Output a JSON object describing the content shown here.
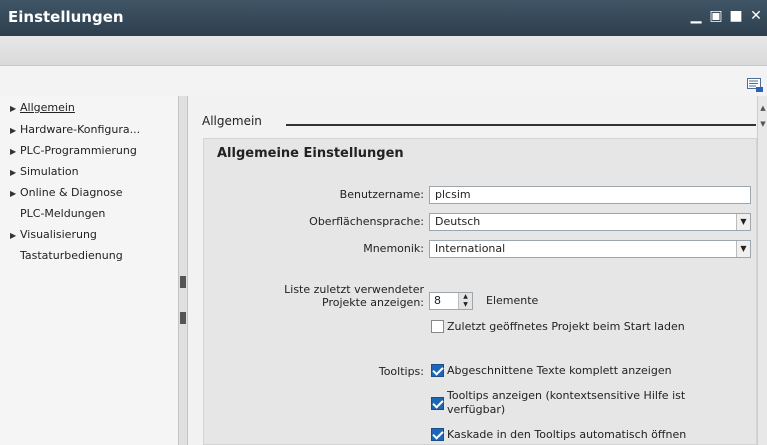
{
  "window": {
    "title": "Einstellungen",
    "controls": {
      "minimize": "▁",
      "restore": "▣",
      "maximize": "■",
      "close": "✕"
    }
  },
  "nav": {
    "items": [
      {
        "label": "Allgemein",
        "expandable": true,
        "active": true
      },
      {
        "label": "Hardware-Konfigura...",
        "expandable": true
      },
      {
        "label": "PLC-Programmierung",
        "expandable": true
      },
      {
        "label": "Simulation",
        "expandable": true
      },
      {
        "label": "Online & Diagnose",
        "expandable": true
      },
      {
        "label": "PLC-Meldungen",
        "expandable": false
      },
      {
        "label": "Visualisierung",
        "expandable": true
      },
      {
        "label": "Tastaturbedienung",
        "expandable": false
      }
    ]
  },
  "section": {
    "title": "Allgemein",
    "group_title": "Allgemeine Einstellungen"
  },
  "form": {
    "username_label": "Benutzername:",
    "username_value": "plcsim",
    "ui_language_label": "Oberflächensprache:",
    "ui_language_value": "Deutsch",
    "mnemonic_label": "Mnemonik:",
    "mnemonic_value": "International",
    "recent_label_1": "Liste zuletzt verwendeter",
    "recent_label_2": "Projekte anzeigen:",
    "recent_count": "8",
    "recent_unit": "Elemente",
    "load_last_project": {
      "label": "Zuletzt geöffnetes Projekt beim Start laden",
      "checked": false
    },
    "tooltips_label": "Tooltips:",
    "tooltip_options": [
      {
        "label": "Abgeschnittene Texte komplett anzeigen",
        "checked": true
      },
      {
        "label_1": "Tooltips anzeigen (kontextsensitive Hilfe ist",
        "label_2": "verfügbar)",
        "checked": true
      },
      {
        "label": "Kaskade in den Tooltips automatisch öffnen",
        "checked": true
      }
    ]
  },
  "colors": {
    "titlebar": "#2d3f4d",
    "checkbox": "#1f66b3"
  }
}
